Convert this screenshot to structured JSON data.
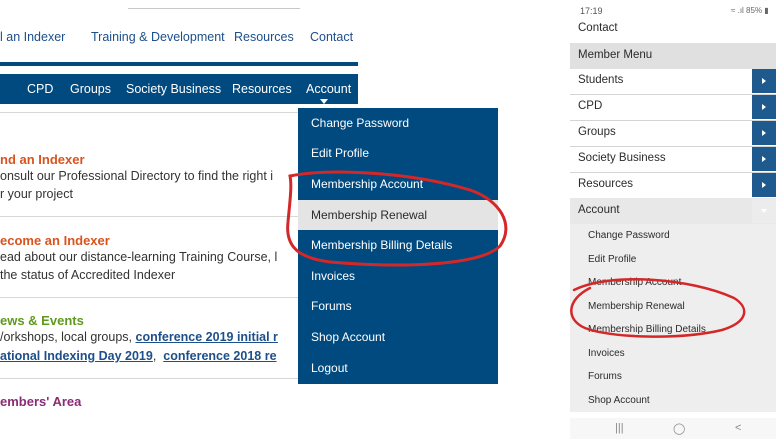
{
  "desktop": {
    "top_nav": [
      "l an Indexer",
      "Training & Development",
      "Resources",
      "Contact"
    ],
    "main_nav": [
      "CPD",
      "Groups",
      "Society Business",
      "Resources",
      "Account"
    ],
    "sections": {
      "find": {
        "title": "nd an Indexer",
        "lines": [
          "onsult our Professional Directory to find the right i",
          "r your project"
        ]
      },
      "become": {
        "title": "ecome an Indexer",
        "lines": [
          "ead about our distance-learning Training Course, l",
          " the status of Accredited Indexer"
        ]
      },
      "news": {
        "title": "ews & Events",
        "line1_text": "/orkshops, local groups, ",
        "line1_link": "conference 2019 initial r",
        "line2_link_a": "ational Indexing Day 2019",
        "line2_sep": ",  ",
        "line2_link_b": "conference 2018 re"
      },
      "members": {
        "title": "embers' Area"
      }
    },
    "dropdown": [
      "Change Password",
      "Edit Profile",
      "Membership Account",
      "Membership Renewal",
      "Membership Billing Details",
      "Invoices",
      "Forums",
      "Shop Account",
      "Logout"
    ],
    "colors": {
      "nav_bg": "#004a80",
      "link": "#1d4f8a",
      "title_orange": "#d9531e",
      "title_green": "#5f9a1e",
      "title_purple": "#8b2b73",
      "annotation": "#d42828"
    }
  },
  "mobile": {
    "status_time": "17:19",
    "status_right": "≈ .ıl 85% ▮",
    "items": [
      "Contact",
      "Member Menu",
      "Students",
      "CPD",
      "Groups",
      "Society Business",
      "Resources",
      "Account"
    ],
    "sub_items": [
      "Change Password",
      "Edit Profile",
      "Membership Account",
      "Membership Renewal",
      "Membership Billing Details",
      "Invoices",
      "Forums",
      "Shop Account"
    ],
    "nav_buttons": [
      "|||",
      "◯",
      "<"
    ]
  }
}
